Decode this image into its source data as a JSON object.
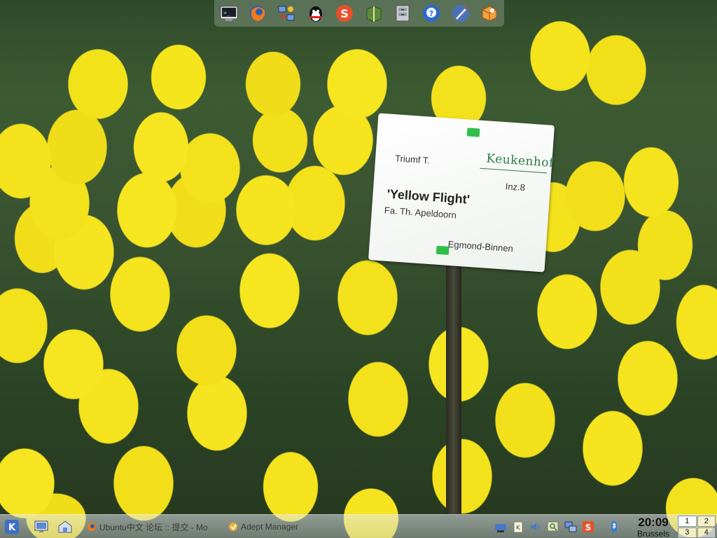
{
  "dock": {
    "icons": [
      {
        "name": "terminal"
      },
      {
        "name": "firefox"
      },
      {
        "name": "network"
      },
      {
        "name": "qq-messenger"
      },
      {
        "name": "skype"
      },
      {
        "name": "dictionary"
      },
      {
        "name": "file-cabinet"
      },
      {
        "name": "pidgin"
      },
      {
        "name": "rocket-launcher"
      },
      {
        "name": "package-installer"
      }
    ]
  },
  "sign": {
    "brand": "Keukenhof",
    "class": "Triumf T.",
    "code": "Inz.8",
    "name": "'Yellow Flight'",
    "grower": "Fa. Th. Apeldoorn",
    "location": "Egmond-Binnen"
  },
  "panel": {
    "tasks": [
      {
        "label": "Ubuntu中文 论坛 :: 提交 - Mo"
      },
      {
        "label": "Adept Manager"
      }
    ],
    "clock": {
      "time": "20:09",
      "city": "Brussels"
    },
    "pager": [
      "1",
      "2",
      "3",
      "4"
    ],
    "active_desktop": "1",
    "colors": {
      "accent": "#6b8fd6",
      "panel": "#d4d9e0"
    }
  }
}
